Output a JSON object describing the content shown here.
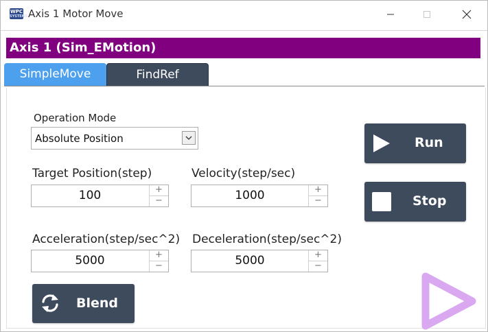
{
  "window": {
    "title": "Axis 1 Motor Move",
    "icon_text": "WPC",
    "icon_subtext": "SYSTEMS"
  },
  "axis_header": {
    "label": "Axis 1 (Sim_EMotion)",
    "color": "#800080"
  },
  "tabs": [
    {
      "label": "SimpleMove",
      "active": true
    },
    {
      "label": "FindRef",
      "active": false
    }
  ],
  "operation_mode": {
    "label": "Operation Mode",
    "selected": "Absolute Position"
  },
  "fields": {
    "target_position": {
      "label": "Target Position(step)",
      "value": "100"
    },
    "velocity": {
      "label": "Velocity(step/sec)",
      "value": "1000"
    },
    "acceleration": {
      "label": "Acceleration(step/sec^2)",
      "value": "5000"
    },
    "deceleration": {
      "label": "Deceleration(step/sec^2)",
      "value": "5000"
    }
  },
  "spin_buttons": {
    "up": "+",
    "down": "−"
  },
  "buttons": {
    "run": "Run",
    "stop": "Stop",
    "blend": "Blend"
  },
  "colors": {
    "tab_active": "#4ca0ee",
    "button_dark": "#3d4b5c",
    "watermark": "#d9a8f0"
  },
  "icons": {
    "run": "play-icon",
    "stop": "square-stop-icon",
    "blend": "refresh-icon",
    "watermark": "play-outline-icon"
  }
}
